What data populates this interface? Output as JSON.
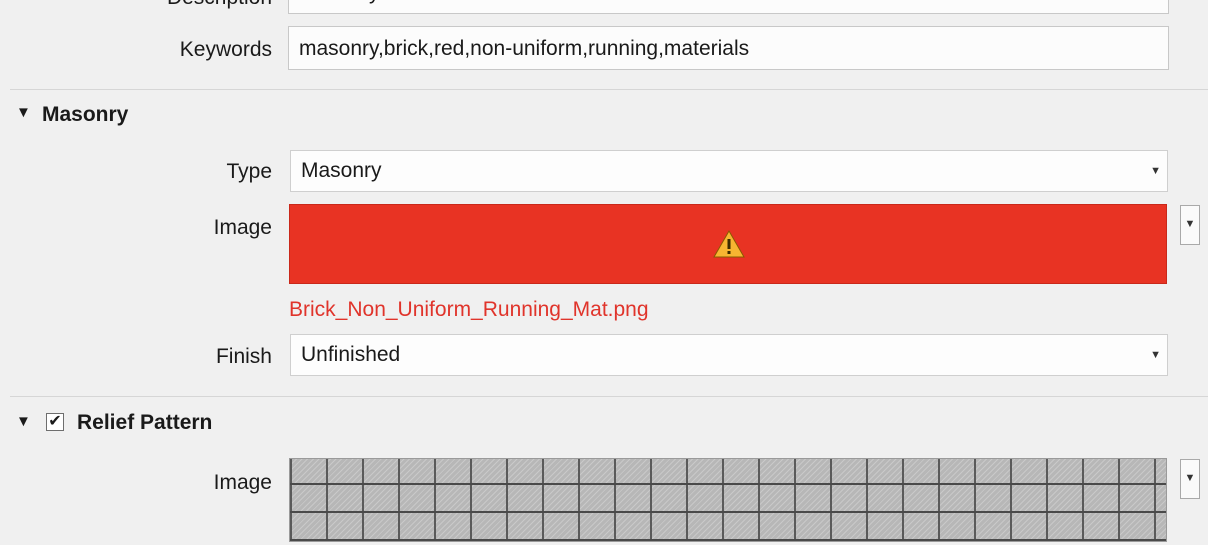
{
  "general": {
    "description_label": "Description",
    "description_value": "Masonry and CMU material",
    "keywords_label": "Keywords",
    "keywords_value": "masonry,brick,red,non-uniform,running,materials"
  },
  "masonry": {
    "section_title": "Masonry",
    "type_label": "Type",
    "type_value": "Masonry",
    "image_label": "Image",
    "image_filename": "Brick_Non_Uniform_Running_Mat.png",
    "image_status": "missing",
    "finish_label": "Finish",
    "finish_value": "Unfinished"
  },
  "relief_pattern": {
    "section_title": "Relief Pattern",
    "checked": true,
    "image_label": "Image"
  },
  "colors": {
    "missing_image_bg": "#e83323",
    "error_text": "#e0342b"
  },
  "icons": {
    "collapse": "triangle-down-icon",
    "warning": "warning-icon",
    "dropdown": "chevron-down-icon",
    "checkbox": "checkmark-icon"
  }
}
